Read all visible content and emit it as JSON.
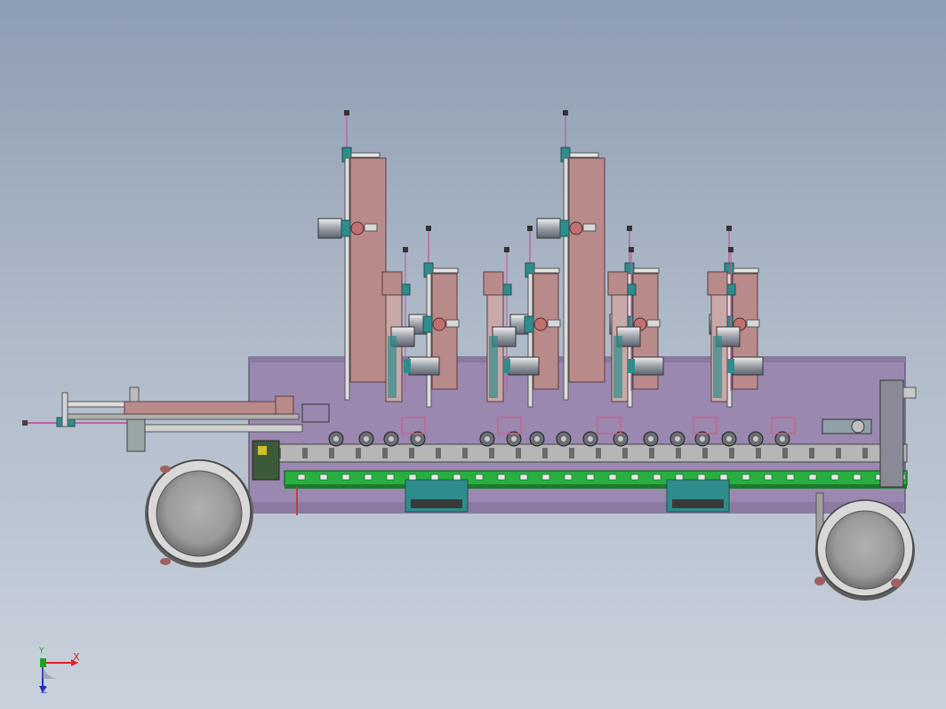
{
  "view": {
    "background_top": "#8d9db2",
    "background_bottom": "#c9d1dc"
  },
  "colors": {
    "frame": "#9a88b0",
    "frame_edge": "#5a4a6a",
    "conveyor": "#27b040",
    "pink_panel": "#b88a8a",
    "teal_block": "#2f8c8c",
    "rod": "#c060a0",
    "bowl_rim": "#d8d8d8",
    "bowl_inner": "#a8a8a8"
  },
  "triad": {
    "x_label": "X",
    "y_label": "Y",
    "z_label": "Z",
    "x_color": "#e02020",
    "y_color": "#20a020",
    "z_color": "#2030c0"
  }
}
